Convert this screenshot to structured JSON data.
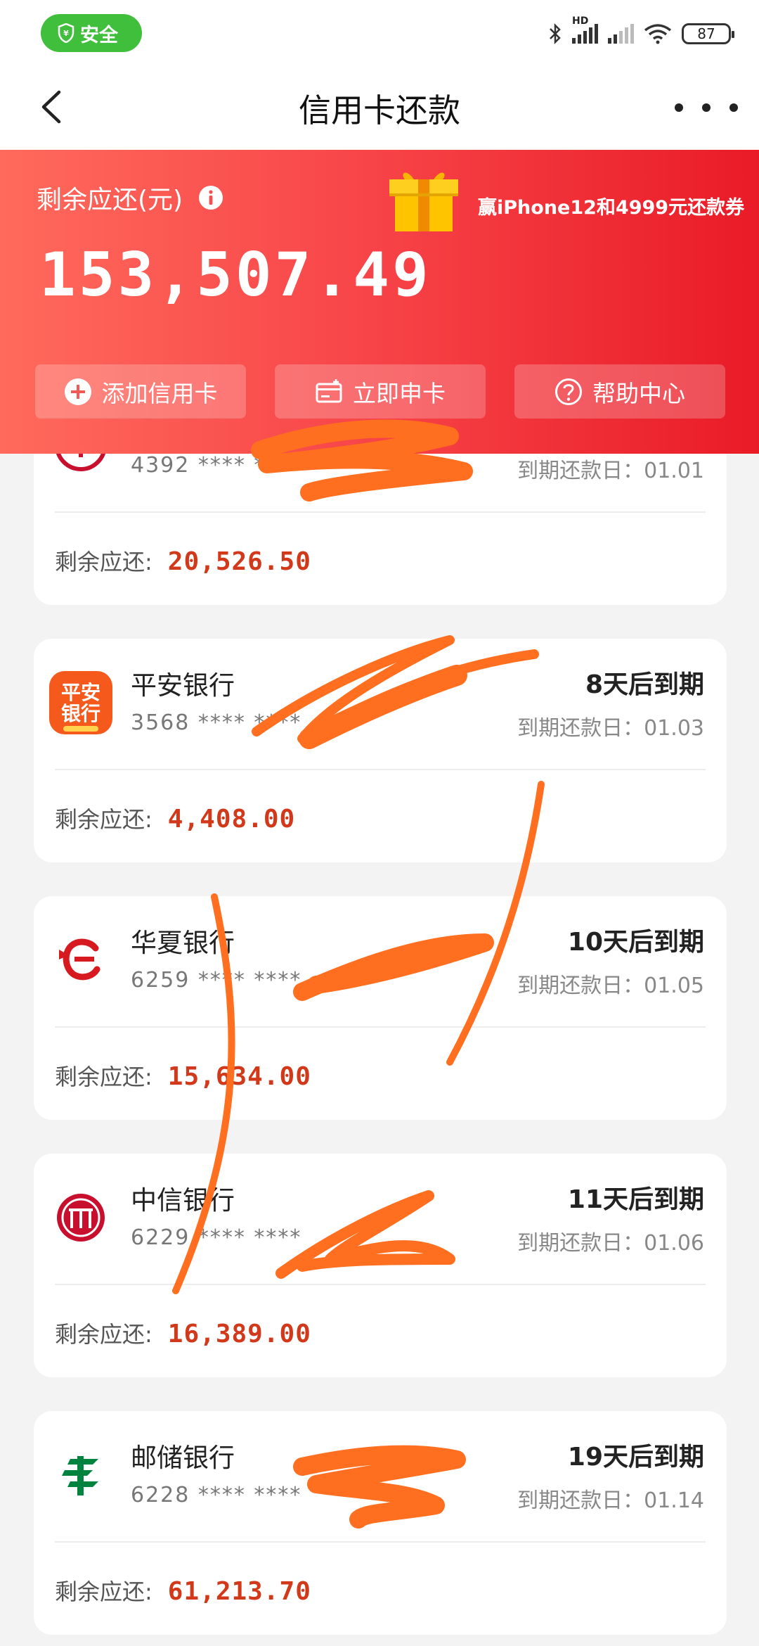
{
  "status_bar": {
    "safe_label": "安全",
    "network_label": "HD",
    "battery": "87"
  },
  "nav": {
    "title": "信用卡还款"
  },
  "header": {
    "remaining_label": "剩余应还(元)",
    "total_amount": "153,507.49",
    "promo_text": "赢iPhone12和4999元还款券",
    "buttons": [
      {
        "label": "添加信用卡",
        "icon": "plus-circle-icon"
      },
      {
        "label": "立即申卡",
        "icon": "card-icon"
      },
      {
        "label": "帮助中心",
        "icon": "question-circle-icon"
      }
    ]
  },
  "colors": {
    "accent_red": "#e91b27",
    "amount_red": "#d2391a",
    "safe_green": "#3fbf3b",
    "scribble_orange": "#ff6f1f"
  },
  "remain_label": "剩余应还:",
  "cards": [
    {
      "bank": "",
      "number": "4392 **** ****",
      "due_status": "",
      "due_date": "到期还款日：01.01",
      "remaining": "20,526.50",
      "logo": "bank-logo-icon"
    },
    {
      "bank": "平安银行",
      "number": "3568 **** ****",
      "due_status": "8天后到期",
      "due_date": "到期还款日：01.03",
      "remaining": "4,408.00",
      "logo": "pingan-logo-icon"
    },
    {
      "bank": "华夏银行",
      "number": "6259 **** ****",
      "due_status": "10天后到期",
      "due_date": "到期还款日：01.05",
      "remaining": "15,634.00",
      "logo": "huaxia-logo-icon"
    },
    {
      "bank": "中信银行",
      "number": "6229 **** ****",
      "due_status": "11天后到期",
      "due_date": "到期还款日：01.06",
      "remaining": "16,389.00",
      "logo": "citic-logo-icon"
    },
    {
      "bank": "邮储银行",
      "number": "6228 **** ****",
      "due_status": "19天后到期",
      "due_date": "到期还款日：01.14",
      "remaining": "61,213.70",
      "logo": "psbc-logo-icon"
    }
  ]
}
